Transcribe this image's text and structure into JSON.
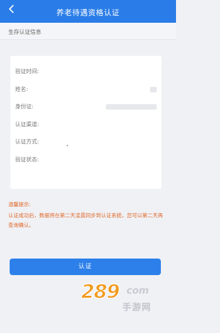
{
  "header": {
    "title": "养老待遇资格认证",
    "back_icon": "chevron-left-icon"
  },
  "section": {
    "label": "生存认证信息"
  },
  "info": {
    "rows": [
      {
        "label": "验证时间:"
      },
      {
        "label": "姓名:"
      },
      {
        "label": "身份证:"
      },
      {
        "label": "认证渠道:"
      },
      {
        "label": "认证方式:"
      },
      {
        "label": "验证状态:"
      }
    ]
  },
  "notice": {
    "heading": "温馨提示:",
    "body": "认证成功后，数据将在第二天凌晨同步到认证系统，您可以第二天再查询确认。"
  },
  "actions": {
    "certify_label": "认证"
  },
  "watermark": {
    "number": "289",
    "suffix": "com",
    "cn": "手游网"
  },
  "colors": {
    "primary": "#2a7de8",
    "notice": "#e06a2c",
    "background": "#f0f1f5"
  }
}
